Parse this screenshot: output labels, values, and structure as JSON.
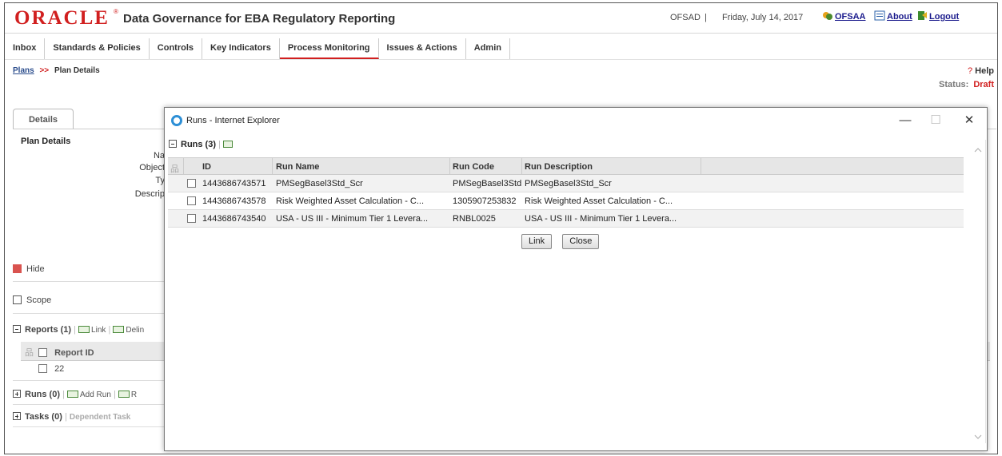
{
  "header": {
    "brand": "ORACLE",
    "app_title": "Data Governance for EBA Regulatory Reporting",
    "user": "OFSAD",
    "separator": "|",
    "date": "Friday, July 14, 2017",
    "ofsaa_link": "OFSAA",
    "about_link": "About",
    "logout_link": "Logout"
  },
  "tabs": [
    "Inbox",
    "Standards & Policies",
    "Controls",
    "Key Indicators",
    "Process Monitoring",
    "Issues & Actions",
    "Admin"
  ],
  "breadcrumb": {
    "parent": "Plans",
    "sep": ">>",
    "current": "Plan Details"
  },
  "help_label": "Help",
  "status": {
    "label": "Status:",
    "value": "Draft"
  },
  "details_tab": "Details",
  "plan_details": {
    "heading": "Plan Details",
    "labels": [
      "Na",
      "Object",
      "Ty",
      "Descrip"
    ]
  },
  "sections": {
    "hide": "Hide",
    "scope": "Scope",
    "reports": {
      "title": "Reports (1)",
      "link": "Link",
      "delink": "Delin",
      "col_report_id": "Report ID",
      "row_value": "22"
    },
    "runs": {
      "title": "Runs (0)",
      "add_run": "Add Run",
      "r": "R"
    },
    "tasks": {
      "title": "Tasks (0)",
      "dependent": "Dependent Task"
    }
  },
  "modal": {
    "title": "Runs - Internet Explorer",
    "minimize": "—",
    "maximize": "☐",
    "close": "✕",
    "runs_label": "Runs (3)",
    "columns": [
      "ID",
      "Run Name",
      "Run Code",
      "Run Description"
    ],
    "rows": [
      {
        "id": "1443686743571",
        "name": "PMSegBasel3Std_Scr",
        "code": "PMSegBasel3Std",
        "desc": "PMSegBasel3Std_Scr"
      },
      {
        "id": "1443686743578",
        "name": "Risk Weighted Asset Calculation - C...",
        "code": "1305907253832",
        "desc": "Risk Weighted Asset Calculation - C..."
      },
      {
        "id": "1443686743540",
        "name": "USA - US III - Minimum Tier 1 Levera...",
        "code": "RNBL0025",
        "desc": "USA - US III - Minimum Tier 1 Levera..."
      }
    ],
    "link_button": "Link",
    "close_button": "Close"
  }
}
